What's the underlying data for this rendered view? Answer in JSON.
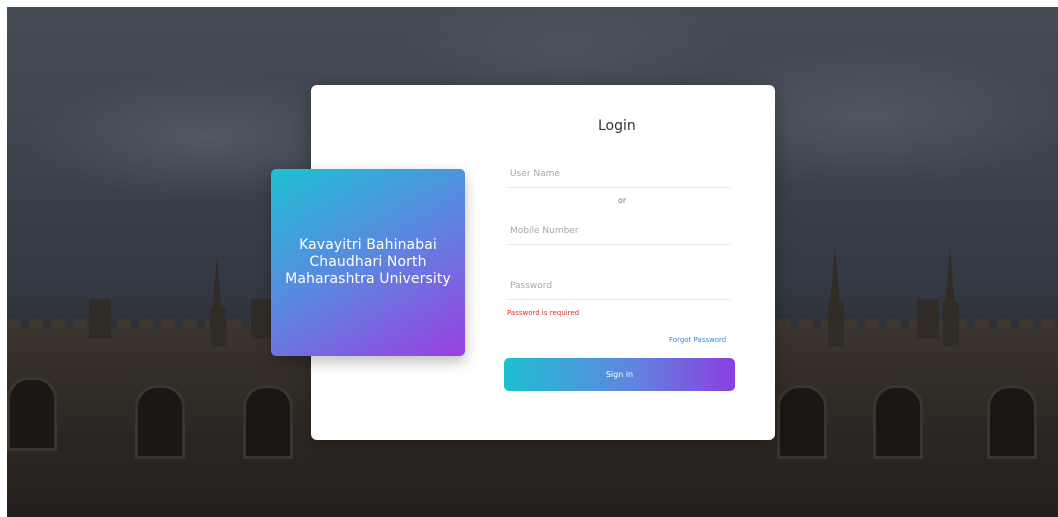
{
  "brand": {
    "university_name": "Kavayitri Bahinabai Chaudhari North Maharashtra University"
  },
  "login": {
    "title": "Login",
    "username_placeholder": "User Name",
    "or_text": "or",
    "mobile_placeholder": "Mobile Number",
    "password_placeholder": "Password",
    "password_error": "Password is required",
    "forgot_password": "Forgot Password",
    "sign_in": "Sign in"
  },
  "colors": {
    "gradient_start": "#1ec0d3",
    "gradient_end": "#9a3fe0",
    "error": "#d9342b",
    "link": "#3b86d6"
  }
}
